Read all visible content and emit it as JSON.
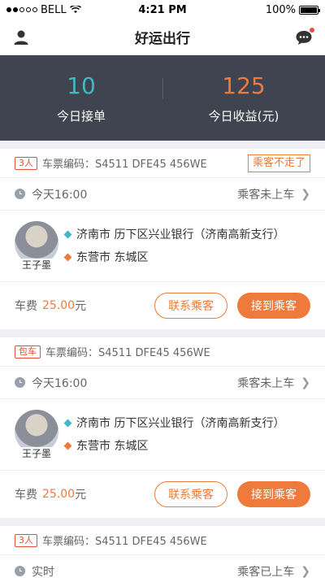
{
  "status_bar": {
    "carrier": "BELL",
    "time": "4:21 PM",
    "battery": "100%"
  },
  "nav": {
    "title": "好运出行"
  },
  "summary": {
    "orders_value": "10",
    "orders_label": "今日接单",
    "earnings_value": "125",
    "earnings_label": "今日收益(元)"
  },
  "cards": [
    {
      "tag": "3人",
      "ticket": "车票编码：S4511 DFE45 456WE",
      "status_tag": "乘客不走了",
      "time": "今天16:00",
      "passenger_status": "乘客未上车",
      "passenger_name": "王子墨",
      "start": "济南市 历下区兴业银行（济南高新支行）",
      "end": "东营市 东城区",
      "fee_label": "车费",
      "fee_amount": "25.00",
      "fee_unit": "元",
      "contact_btn": "联系乘客",
      "pickup_btn": "接到乘客"
    },
    {
      "tag": "包车",
      "ticket": "车票编码：S4511 DFE45 456WE",
      "time": "今天16:00",
      "passenger_status": "乘客未上车",
      "passenger_name": "王子墨",
      "start": "济南市 历下区兴业银行（济南高新支行）",
      "end": "东营市 东城区",
      "fee_label": "车费",
      "fee_amount": "25.00",
      "fee_unit": "元",
      "contact_btn": "联系乘客",
      "pickup_btn": "接到乘客"
    },
    {
      "tag": "3人",
      "ticket": "车票编码：S4511 DFE45 456WE",
      "time": "实时",
      "passenger_status": "乘客已上车"
    }
  ],
  "colors": {
    "accent": "#ee7a3b",
    "teal": "#3fb7c4",
    "header_bg": "#3f4450"
  }
}
